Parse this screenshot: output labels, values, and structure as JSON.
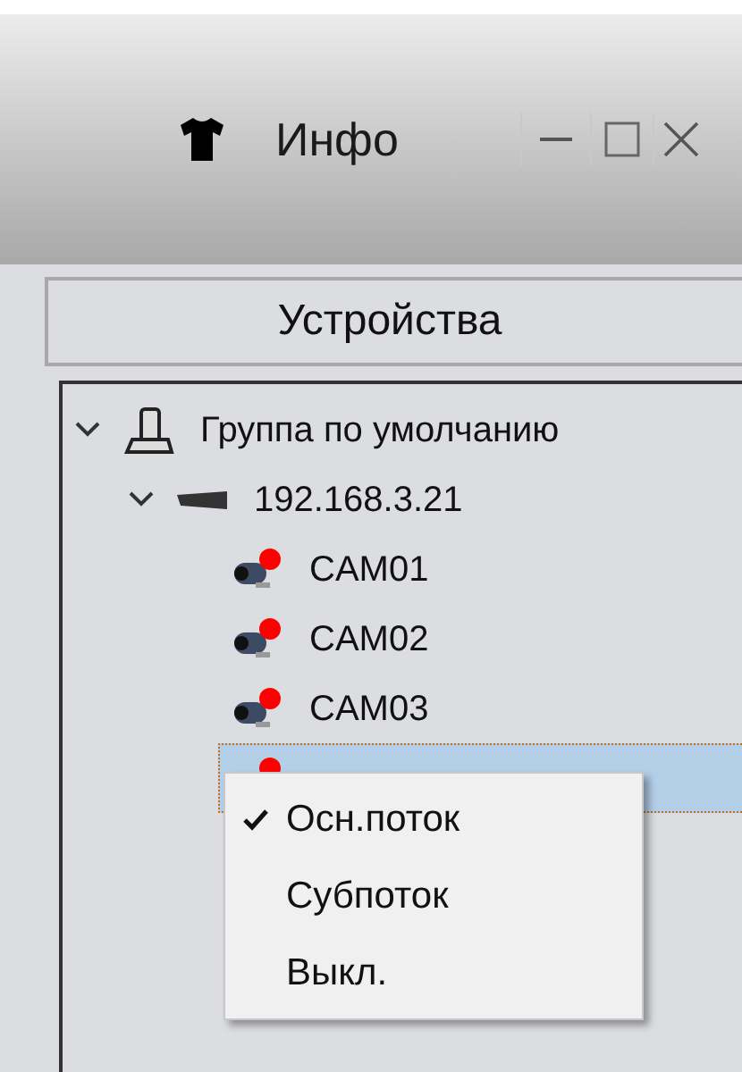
{
  "window": {
    "title": "Инфо"
  },
  "panel": {
    "header": "Устройства"
  },
  "tree": [
    {
      "kind": "group",
      "label": "Группа по умолчанию",
      "expanded": true,
      "selected": false,
      "children": [
        {
          "kind": "device",
          "label": "192.168.3.21",
          "expanded": true,
          "selected": false,
          "children": [
            {
              "kind": "camera",
              "label": "CAM01",
              "selected": false
            },
            {
              "kind": "camera",
              "label": "CAM02",
              "selected": false
            },
            {
              "kind": "camera",
              "label": "CAM03",
              "selected": false
            },
            {
              "kind": "camera",
              "selected": true
            }
          ]
        }
      ]
    }
  ],
  "context_menu": [
    {
      "label": "Осн.поток",
      "checked": true
    },
    {
      "label": "Субпоток",
      "checked": false
    },
    {
      "label": "Выкл.",
      "checked": false
    }
  ]
}
